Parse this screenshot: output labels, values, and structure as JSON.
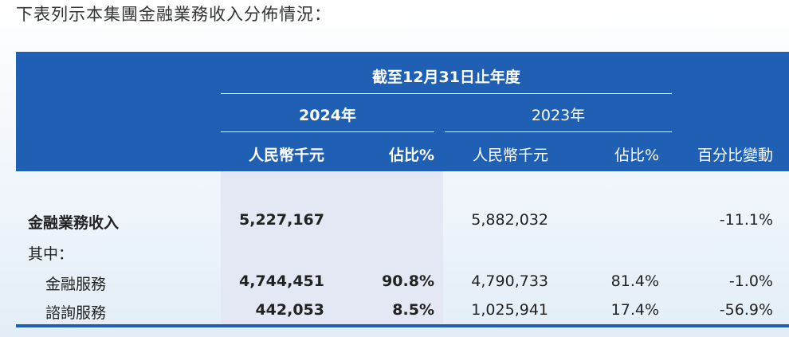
{
  "intro": "下表列示本集團金融業務收入分佈情況：",
  "header": {
    "period": "截至12月31日止年度",
    "year_2024": "2024年",
    "year_2023": "2023年",
    "col_rmb_2024": "人民幣千元",
    "col_pct_2024": "佔比%",
    "col_rmb_2023": "人民幣千元",
    "col_pct_2023": "佔比%",
    "col_change": "百分比變動"
  },
  "rows": [
    {
      "label": "金融業務收入",
      "rmb_2024": "5,227,167",
      "pct_2024": "",
      "rmb_2023": "5,882,032",
      "pct_2023": "",
      "change": "-11.1%"
    },
    {
      "label": "其中：",
      "rmb_2024": "",
      "pct_2024": "",
      "rmb_2023": "",
      "pct_2023": "",
      "change": ""
    },
    {
      "label": "金融服務",
      "rmb_2024": "4,744,451",
      "pct_2024": "90.8%",
      "rmb_2023": "4,790,733",
      "pct_2023": "81.4%",
      "change": "-1.0%"
    },
    {
      "label": "諮詢服務",
      "rmb_2024": "442,053",
      "pct_2024": "8.5%",
      "rmb_2023": "1,025,941",
      "pct_2023": "17.4%",
      "change": "-56.9%"
    }
  ],
  "colors": {
    "header": "#2060b4",
    "highlight_col": "#e4e8f5"
  }
}
